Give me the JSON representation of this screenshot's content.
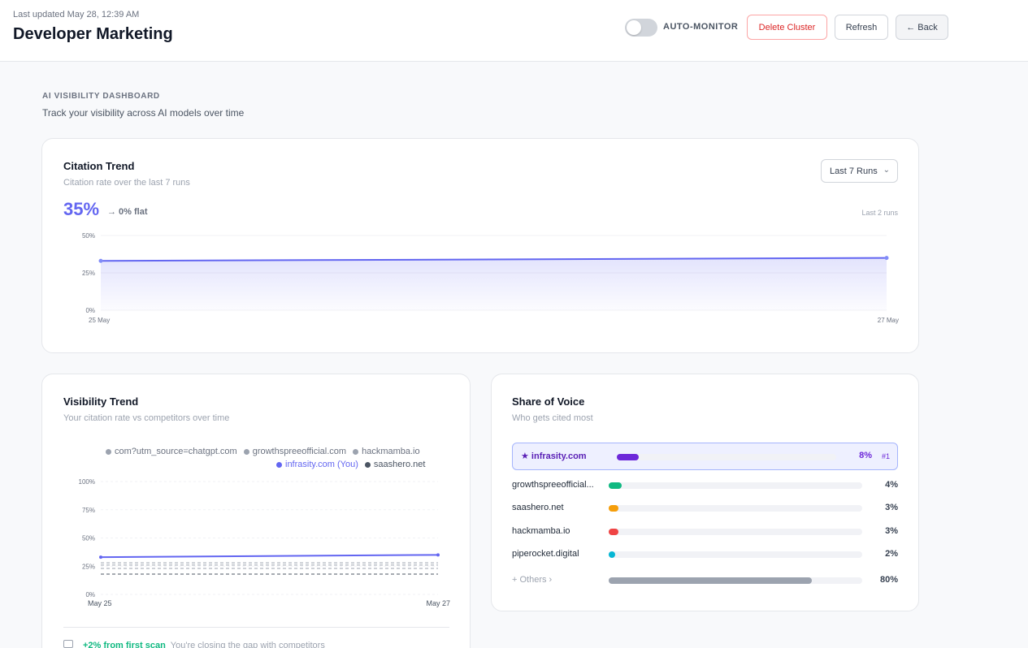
{
  "header": {
    "last_updated": "Last updated May 28, 12:39 AM",
    "title": "Developer Marketing",
    "auto_monitor_label": "AUTO-MONITOR",
    "auto_monitor_on": false,
    "delete_label": "Delete Cluster",
    "refresh_label": "Refresh",
    "back_label": "← Back"
  },
  "dashboard": {
    "section_label": "AI VISIBILITY DASHBOARD",
    "section_sub": "Track your visibility across AI models over time"
  },
  "citation_trend": {
    "title": "Citation Trend",
    "subtitle": "Citation rate over the last 7 runs",
    "value": "35%",
    "delta": "→ 0% flat",
    "runs_select": "Last 7 Runs",
    "runs_note": "Last 2 runs",
    "accent": "#6366f1",
    "chart_data": {
      "type": "area",
      "x": [
        "25 May",
        "27 May"
      ],
      "y": [
        33,
        35
      ],
      "y_ticks": [
        "50%",
        "25%",
        "0%"
      ],
      "ylim": [
        0,
        50
      ]
    }
  },
  "visibility_trend": {
    "title": "Visibility Trend",
    "subtitle": "Your citation rate vs competitors over time",
    "legend": [
      {
        "name": "com?utm_source=chatgpt.com",
        "color": "#9ca3af"
      },
      {
        "name": "growthspreeofficial.com",
        "color": "#9ca3af"
      },
      {
        "name": "hackmamba.io",
        "color": "#9ca3af"
      },
      {
        "name": "infrasity.com (You)",
        "color": "#6366f1"
      },
      {
        "name": "saashero.net",
        "color": "#4b5563"
      }
    ],
    "footer_delta": "+2% from first scan",
    "footer_text": "You're closing the gap with competitors",
    "chart_data": {
      "type": "line",
      "x": [
        "May 25",
        "May 27"
      ],
      "y_ticks": [
        "100%",
        "75%",
        "50%",
        "25%",
        "0%"
      ],
      "ylim": [
        0,
        100
      ],
      "series": [
        {
          "name": "infrasity.com (You)",
          "values": [
            33,
            35
          ],
          "color": "#6366f1"
        },
        {
          "name": "com?utm_source=chatgpt.com",
          "values": [
            28,
            28
          ],
          "color": "#9ca3af"
        },
        {
          "name": "growthspreeofficial.com",
          "values": [
            26,
            26
          ],
          "color": "#9ca3af"
        },
        {
          "name": "hackmamba.io",
          "values": [
            23,
            23
          ],
          "color": "#9ca3af"
        },
        {
          "name": "saashero.net",
          "values": [
            18,
            18
          ],
          "color": "#4b5563"
        }
      ]
    }
  },
  "share_of_voice": {
    "title": "Share of Voice",
    "subtitle": "Who gets cited most",
    "highlight": {
      "name": "★ infrasity.com",
      "pct": "8%",
      "rank": "#1",
      "value": 8,
      "color": "#6d28d9"
    },
    "rows": [
      {
        "name": "growthspreeofficial...",
        "pct": "4%",
        "value": 4,
        "color": "#10b981"
      },
      {
        "name": "saashero.net",
        "pct": "3%",
        "value": 3,
        "color": "#f59e0b"
      },
      {
        "name": "hackmamba.io",
        "pct": "3%",
        "value": 3,
        "color": "#ef4444"
      },
      {
        "name": "piperocket.digital",
        "pct": "2%",
        "value": 2,
        "color": "#06b6d4"
      }
    ],
    "others": {
      "name": "+ Others ›",
      "pct": "80%",
      "value": 80,
      "color": "#9ca3af"
    }
  }
}
